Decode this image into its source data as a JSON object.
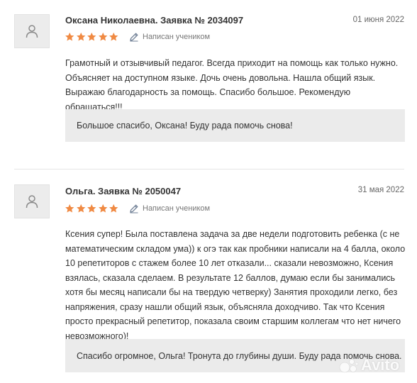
{
  "reviews": [
    {
      "author": "Оксана Николаевна. Заявка № 2034097",
      "date": "01 июня 2022",
      "rating": 5,
      "written_by": "Написан учеником",
      "text": "Грамотный и отзывчивый педагог. Всегда приходит на помощь как только нужно. Объясняет на доступном языке. Дочь очень довольна. Нашла общий язык. Выражаю благодарность за помощь. Спасибо большое. Рекомендую обращаться!!!",
      "reply": "Большое спасибо, Оксана! Буду рада помочь снова!"
    },
    {
      "author": "Ольга. Заявка № 2050047",
      "date": "31 мая 2022",
      "rating": 5,
      "written_by": "Написан учеником",
      "text": "Ксения супер! Была поставлена задача за две недели подготовить ребенка (с не математическим складом ума)) к огэ так как пробники написали на 4 балла, около 10 репетиторов с стажем более 10 лет отказали... сказали невозможно, Ксения взялась, сказала сделаем. В результате 12 баллов, думаю если бы занимались хотя бы месяц написали бы на твердую четверку) Занятия проходили легко, без напряжения, сразу нашли общий язык, объясняла доходчиво. Так что Ксения просто прекрасный репетитор, показала своим старшим коллегам что нет ничего невозможного)!",
      "reply": "Спасибо огромное, Ольга! Тронута до глубины души. Буду рада помочь снова."
    }
  ],
  "watermark": "Avito",
  "colors": {
    "star": "#f08a43",
    "reply_bg": "#ebebeb",
    "avatar_bg": "#ececec"
  },
  "icons": {
    "avatar": "user-icon",
    "written": "pencil-icon",
    "star": "star-icon"
  }
}
